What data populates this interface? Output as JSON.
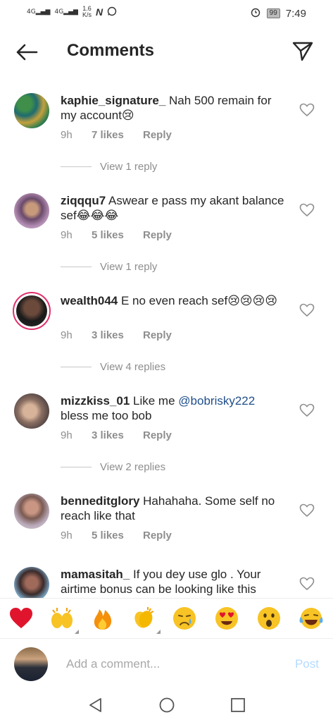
{
  "status_bar": {
    "signal1": "4G",
    "signal2": "4G",
    "speed_value": "1.6",
    "speed_unit": "K/s",
    "battery": "99",
    "time": "7:49"
  },
  "header": {
    "title": "Comments"
  },
  "comments": [
    {
      "username": "kaphie_signature_",
      "text": " Nah 500 remain for my account😢",
      "time": "9h",
      "likes": "7 likes",
      "reply": "Reply",
      "view_replies": "View 1 reply"
    },
    {
      "username": "ziqqqu7",
      "text": " Aswear e pass my akant balance sef😂😂😂",
      "time": "9h",
      "likes": "5 likes",
      "reply": "Reply",
      "view_replies": "View 1 reply"
    },
    {
      "username": "wealth044",
      "text": " E no even reach sef😢😢😢😢",
      "time": "9h",
      "likes": "3 likes",
      "reply": "Reply",
      "view_replies": "View 4 replies"
    },
    {
      "username": "mizzkiss_01",
      "text_before": " Like me ",
      "mention": "@bobrisky222",
      "text_after": " bless me too bob",
      "time": "9h",
      "likes": "3 likes",
      "reply": "Reply",
      "view_replies": "View 2 replies"
    },
    {
      "username": "benneditglory",
      "text": " Hahahaha. Some self no reach like that",
      "time": "9h",
      "likes": "5 likes",
      "reply": "Reply"
    },
    {
      "username": "mamasitah_",
      "text": " If you dey use glo . Your airtime bonus can be looking like this"
    }
  ],
  "reactions": [
    "heart",
    "raising-hands",
    "fire",
    "clapping-hands",
    "crying-face",
    "heart-eyes",
    "astonished-face",
    "tears-of-joy"
  ],
  "composer": {
    "placeholder": "Add a comment...",
    "post_label": "Post"
  },
  "colors": {
    "accent": "#e1306c",
    "link": "#1f4e8a",
    "meta": "#8e8e8e",
    "post_disabled": "#b3dbff"
  }
}
